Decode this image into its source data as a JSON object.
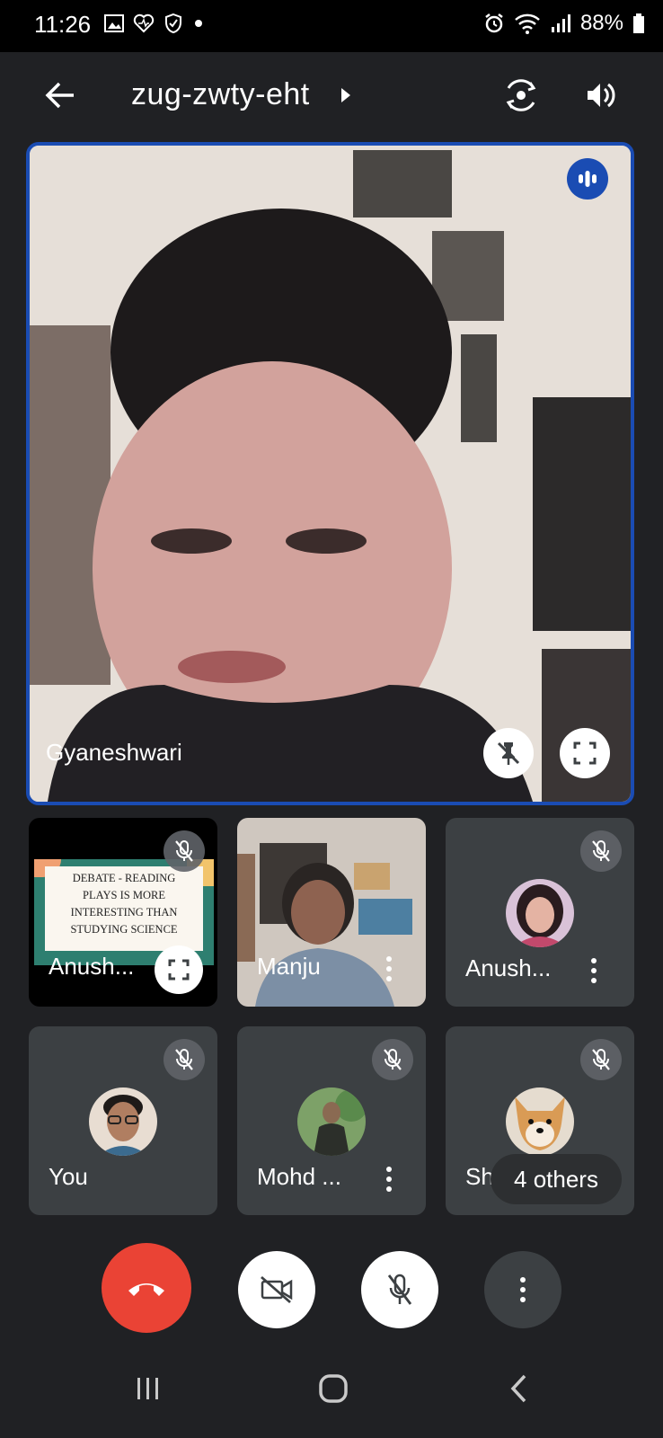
{
  "status_bar": {
    "time": "11:26",
    "battery": "88%",
    "icons": [
      "gallery-icon",
      "health-icon",
      "shield-icon",
      "dot-icon",
      "alarm-icon",
      "wifi-icon",
      "signal-icon",
      "battery-icon"
    ]
  },
  "header": {
    "meeting_code": "zug-zwty-eht",
    "icons": [
      "back-arrow-icon",
      "chevron-right-icon",
      "switch-camera-icon",
      "speaker-icon"
    ]
  },
  "main_participant": {
    "name": "Gyaneshwari",
    "speaking": true,
    "icons": [
      "speaking-indicator-icon",
      "unpin-icon",
      "fullscreen-icon"
    ]
  },
  "participants": [
    {
      "name": "Anush...",
      "type": "presentation",
      "slide_lines": [
        "DEBATE - READING",
        "PLAYS IS MORE",
        "INTERESTING THAN",
        "STUDYING SCIENCE"
      ],
      "muted": true
    },
    {
      "name": "Manju",
      "type": "video",
      "muted": false
    },
    {
      "name": "Anush...",
      "type": "avatar",
      "muted": true
    },
    {
      "name": "You",
      "type": "avatar",
      "muted": true
    },
    {
      "name": "Mohd ...",
      "type": "avatar",
      "muted": true
    },
    {
      "name": "Shal",
      "type": "avatar",
      "muted": true,
      "overflow_label": "4 others"
    }
  ],
  "controls": {
    "end_call_color": "#ea4335",
    "icons": [
      "end-call-icon",
      "camera-off-icon",
      "mic-off-icon",
      "more-options-icon"
    ]
  },
  "colors": {
    "background": "#202124",
    "tile": "#3c4043",
    "active_border": "#1a4cb3"
  }
}
